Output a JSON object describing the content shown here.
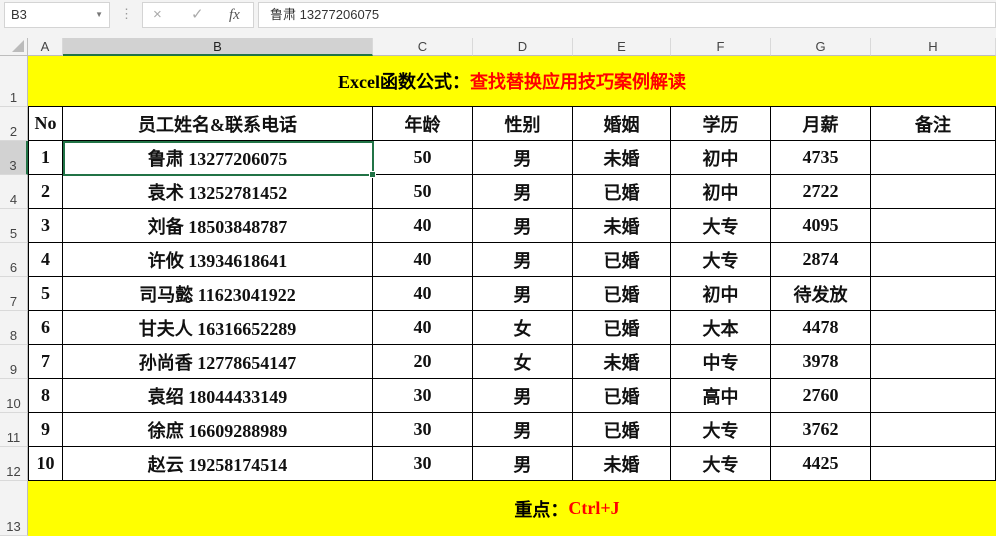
{
  "formula_bar": {
    "name_box": "B3",
    "cancel_icon": "×",
    "enter_icon": "✓",
    "fx_label": "fx",
    "formula": "鲁肃 13277206075"
  },
  "columns": [
    "A",
    "B",
    "C",
    "D",
    "E",
    "F",
    "G",
    "H"
  ],
  "rows": [
    "1",
    "2",
    "3",
    "4",
    "5",
    "6",
    "7",
    "8",
    "9",
    "10",
    "11",
    "12",
    "13"
  ],
  "title": {
    "black": "Excel函数公式：",
    "red": "查找替换应用技巧案例解读"
  },
  "headers": [
    "No",
    "员工姓名&联系电话",
    "年龄",
    "性别",
    "婚姻",
    "学历",
    "月薪",
    "备注"
  ],
  "table": [
    [
      "1",
      "鲁肃 13277206075",
      "50",
      "男",
      "未婚",
      "初中",
      "4735",
      ""
    ],
    [
      "2",
      "袁术 13252781452",
      "50",
      "男",
      "已婚",
      "初中",
      "2722",
      ""
    ],
    [
      "3",
      "刘备 18503848787",
      "40",
      "男",
      "未婚",
      "大专",
      "4095",
      ""
    ],
    [
      "4",
      "许攸 13934618641",
      "40",
      "男",
      "已婚",
      "大专",
      "2874",
      ""
    ],
    [
      "5",
      "司马懿 11623041922",
      "40",
      "男",
      "已婚",
      "初中",
      "待发放",
      ""
    ],
    [
      "6",
      "甘夫人 16316652289",
      "40",
      "女",
      "已婚",
      "大本",
      "4478",
      ""
    ],
    [
      "7",
      "孙尚香 12778654147",
      "20",
      "女",
      "未婚",
      "中专",
      "3978",
      ""
    ],
    [
      "8",
      "袁绍 18044433149",
      "30",
      "男",
      "已婚",
      "高中",
      "2760",
      ""
    ],
    [
      "9",
      "徐庶 16609288989",
      "30",
      "男",
      "已婚",
      "大专",
      "3762",
      ""
    ],
    [
      "10",
      "赵云 19258174514",
      "30",
      "男",
      "未婚",
      "大专",
      "4425",
      ""
    ]
  ],
  "footer": {
    "black": "重点：",
    "red": "Ctrl+J"
  }
}
